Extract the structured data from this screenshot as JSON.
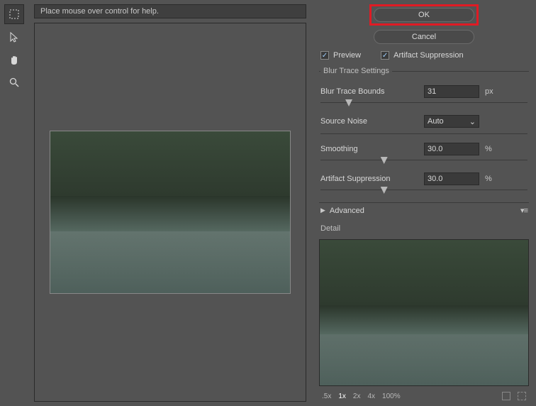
{
  "hint": "Place mouse over control for help.",
  "buttons": {
    "ok": "OK",
    "cancel": "Cancel"
  },
  "checks": {
    "preview": "Preview",
    "artifact": "Artifact Suppression"
  },
  "group": {
    "title": "Blur Trace Settings",
    "bounds_label": "Blur Trace Bounds",
    "bounds_value": "31",
    "bounds_unit": "px",
    "noise_label": "Source Noise",
    "noise_value": "Auto",
    "smooth_label": "Smoothing",
    "smooth_value": "30.0",
    "smooth_unit": "%",
    "suppress_label": "Artifact Suppression",
    "suppress_value": "30.0",
    "suppress_unit": "%"
  },
  "advanced": "Advanced",
  "detail": "Detail",
  "zoom": {
    "z05": ".5x",
    "z1": "1x",
    "z2": "2x",
    "z4": "4x",
    "z100": "100%"
  }
}
